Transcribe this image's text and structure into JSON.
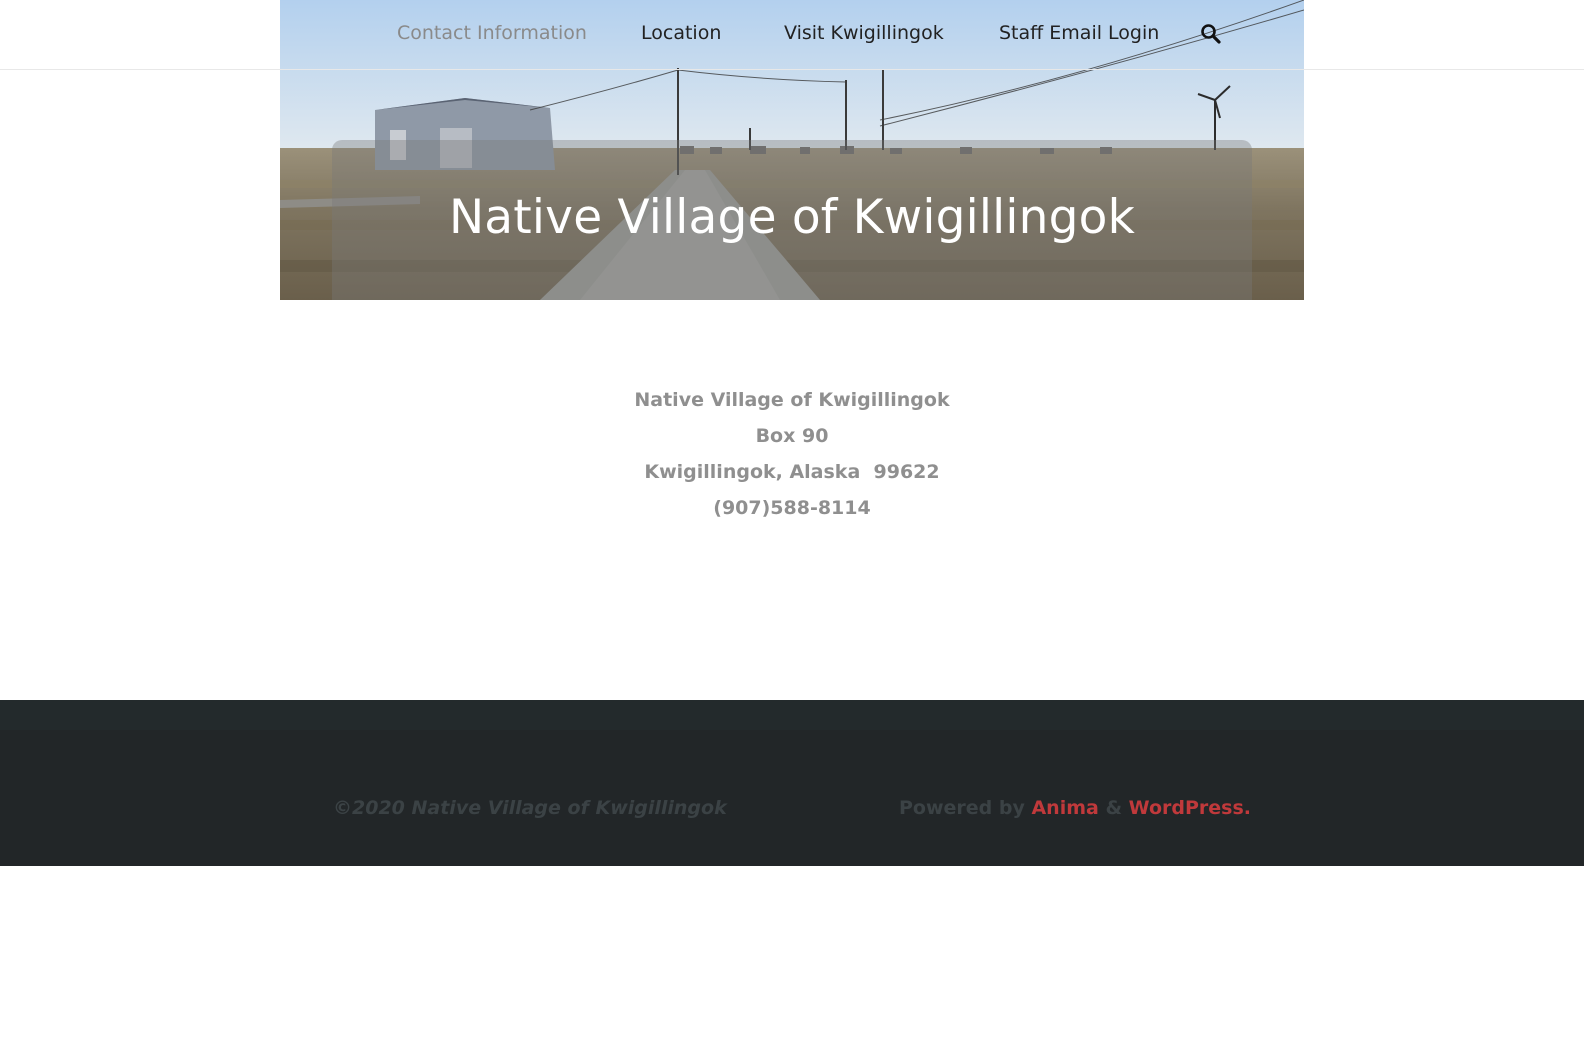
{
  "nav": {
    "items": [
      {
        "label": "Contact Information",
        "active": true
      },
      {
        "label": "Location",
        "active": false
      },
      {
        "label": "Visit Kwigillingok",
        "active": false
      },
      {
        "label": "Staff Email Login",
        "active": false
      }
    ],
    "search_icon": "search-icon"
  },
  "hero": {
    "title": "Native Village of Kwigillingok"
  },
  "contact": {
    "name": "Native Village of Kwigillingok",
    "box": "Box 90",
    "city": "Kwigillingok, Alaska  99622",
    "phone": "(907)588-8114"
  },
  "footer": {
    "copyright": "©2020 Native Village of Kwigillingok",
    "powered_prefix": "Powered by",
    "anima_link": "Anima",
    "ampersand": "&",
    "wordpress_link": "WordPress."
  },
  "colors": {
    "link_accent": "#c0393b",
    "footer_bg": "#222628",
    "contact_text": "#8f8f8f"
  }
}
